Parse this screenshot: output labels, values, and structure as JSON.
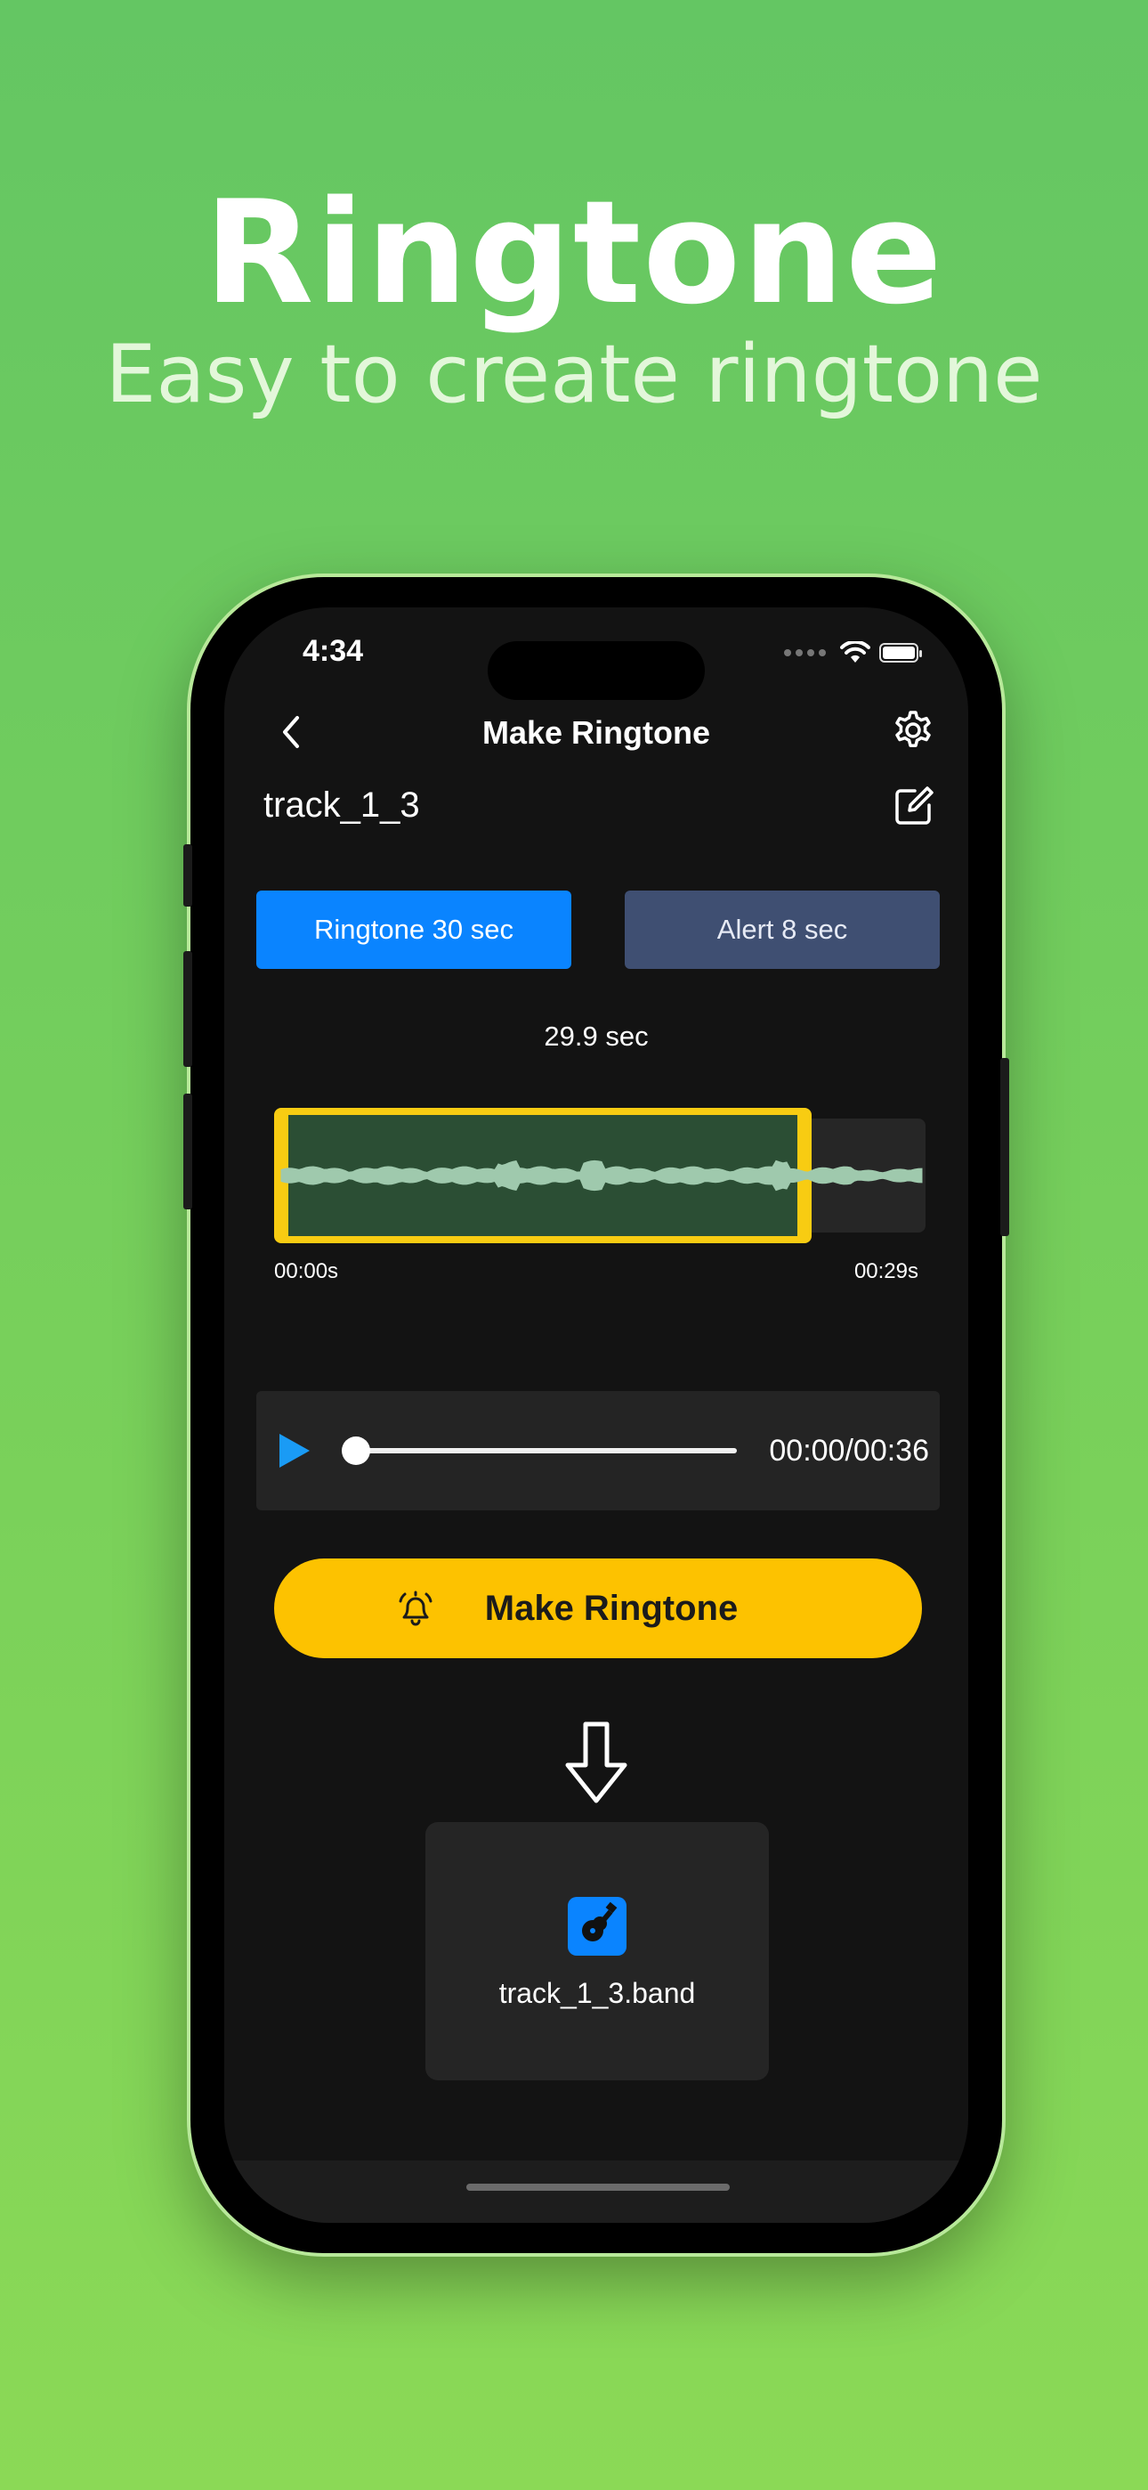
{
  "hero": {
    "title": "Ringtone",
    "subtitle": "Easy to create ringtone"
  },
  "status_bar": {
    "time": "4:34"
  },
  "nav": {
    "title": "Make Ringtone",
    "back_icon": "chevron-left-icon",
    "settings_icon": "gear-icon"
  },
  "track": {
    "name": "track_1_3",
    "edit_icon": "edit-icon"
  },
  "segments": {
    "ringtone_label": "Ringtone 30 sec",
    "alert_label": "Alert 8 sec",
    "selected": "ringtone"
  },
  "waveform": {
    "duration_label": "29.9 sec",
    "start_label": "00:00s",
    "end_label": "00:29s"
  },
  "player": {
    "time": "00:00/00:36",
    "progress": 0
  },
  "actions": {
    "make_label": "Make Ringtone",
    "make_icon": "bell-icon"
  },
  "output": {
    "file_name": "track_1_3.band",
    "icon": "garageband-guitar-icon"
  },
  "colors": {
    "accent_blue": "#0a84ff",
    "alert_button": "#3f4f72",
    "make_button": "#fdc200",
    "selection_border": "#f8cc12",
    "background_green": "#64c663"
  }
}
